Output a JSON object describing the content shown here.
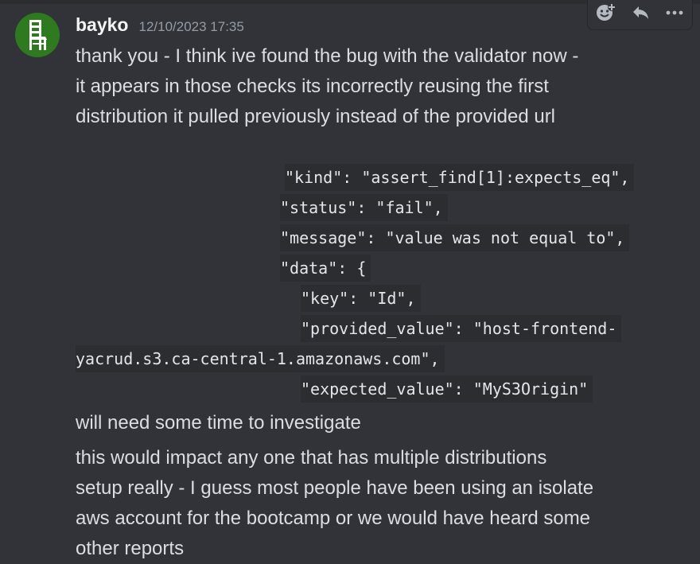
{
  "message": {
    "username": "bayko",
    "timestamp": "12/10/2023 17:35",
    "text_lines": [
      "thank you - I think ive found the bug with the validator now -",
      "it appears in those checks its incorrectly reusing the first",
      "distribution it pulled previously instead of the provided url"
    ],
    "code_lines": [
      "\"kind\": \"assert_find[1]:expects_eq\",",
      "\"status\": \"fail\",",
      "\"message\": \"value was not equal to\",",
      "\"data\": {",
      "\"key\": \"Id\",",
      "\"provided_value\": \"host-frontend-",
      "yacrud.s3.ca-central-1.amazonaws.com\",",
      "\"expected_value\": \"MyS3Origin\""
    ],
    "followup_1": "will need some time to investigate",
    "followup_2_lines": [
      "this would impact any one that has multiple distributions",
      "setup really - I guess most people have been using an isolate",
      "aws account for the bootcamp or we would have heard some",
      "other reports"
    ]
  },
  "toolbar": {
    "icons": [
      "add-reaction-icon",
      "reply-icon",
      "more-icon"
    ]
  },
  "colors": {
    "background": "#323339",
    "code_background": "#2b2d31",
    "username": "#f2f3f5",
    "timestamp": "#949ba4",
    "text": "#dbdee1",
    "avatar": "#2d7a1f"
  }
}
